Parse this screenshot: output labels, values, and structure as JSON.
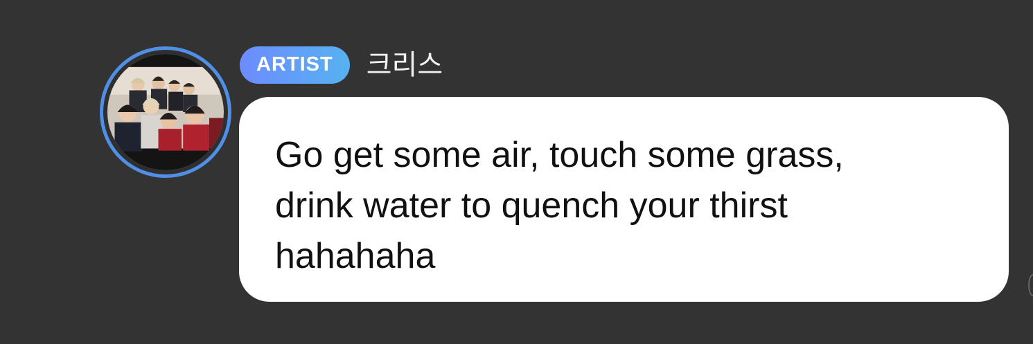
{
  "message": {
    "badge_label": "ARTIST",
    "sender_name": "크리스",
    "text": "Go get some air, touch some grass,\ndrink water to quench your thirst\nhahahaha",
    "avatar_icon": "group-photo-avatar"
  },
  "colors": {
    "background": "#333333",
    "badge_start": "#6d8cff",
    "badge_end": "#56b2f0",
    "avatar_ring": "#4f8fe6",
    "bubble": "#ffffff",
    "text": "#111111"
  }
}
